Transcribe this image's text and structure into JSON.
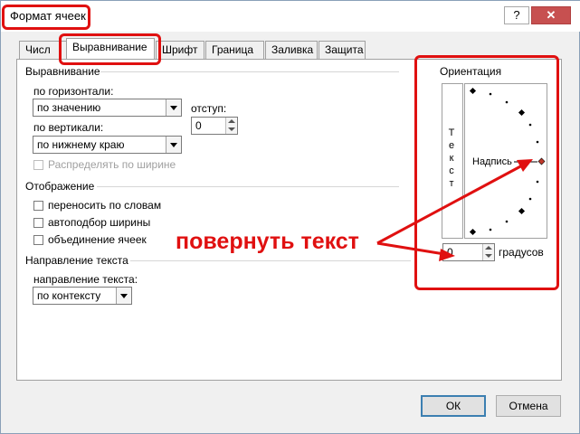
{
  "window": {
    "title": "Формат ячеек",
    "help_label": "?",
    "close_label": "✕"
  },
  "tabs": [
    {
      "label": "Числ"
    },
    {
      "label": "Выравнивание"
    },
    {
      "label": "Шрифт"
    },
    {
      "label": "Граница"
    },
    {
      "label": "Заливка"
    },
    {
      "label": "Защита"
    }
  ],
  "alignment": {
    "group_title": "Выравнивание",
    "horizontal_label": "по горизонтали:",
    "horizontal_value": "по значению",
    "indent_label": "отступ:",
    "indent_value": "0",
    "vertical_label": "по вертикали:",
    "vertical_value": "по нижнему краю",
    "distribute_label": "Распределять по ширине"
  },
  "display": {
    "group_title": "Отображение",
    "wrap_label": "переносить по словам",
    "shrink_label": "автоподбор ширины",
    "merge_label": "объединение ячеек"
  },
  "direction": {
    "group_title": "Направление текста",
    "label": "направление текста:",
    "value": "по контексту"
  },
  "orientation": {
    "group_title": "Ориентация",
    "vertical_text": "Текст",
    "caption": "Надпись",
    "degrees_label": "градусов",
    "degrees_value": "0"
  },
  "annotation": {
    "text": "повернуть текст"
  },
  "footer": {
    "ok_label": "ОК",
    "cancel_label": "Отмена"
  },
  "colors": {
    "highlight": "#e01010",
    "dialog_bg": "#f0f0f0",
    "default_button_border": "#3c7fb1"
  }
}
